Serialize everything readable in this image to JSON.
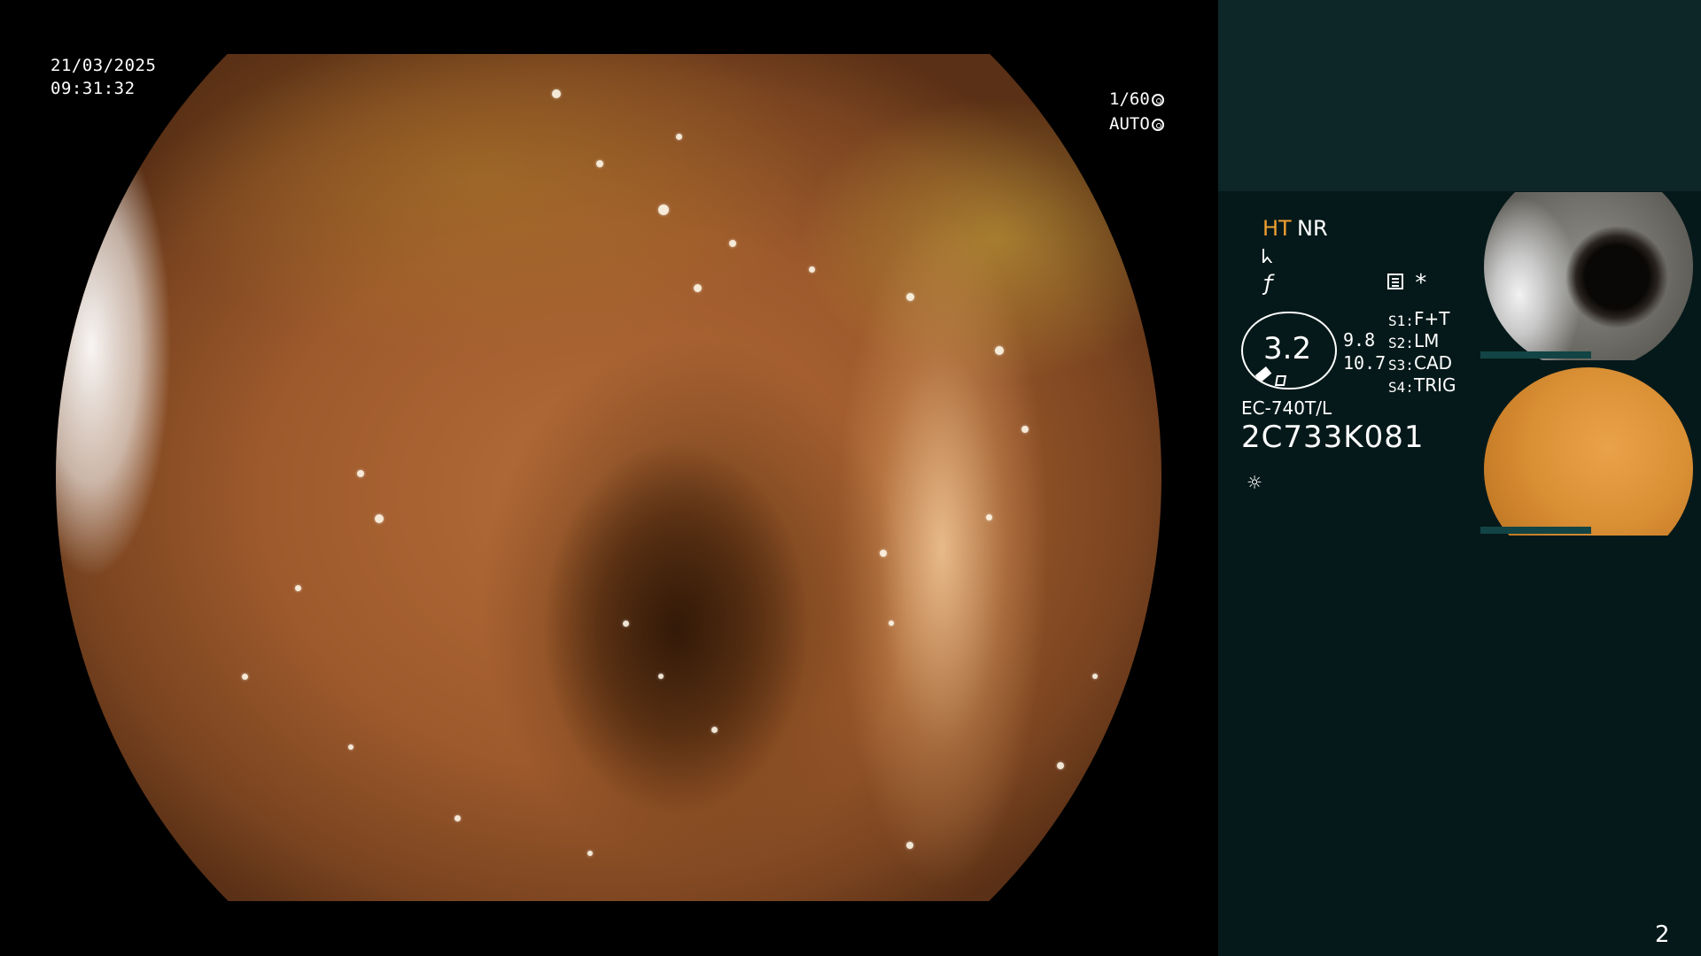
{
  "overlay": {
    "date": "21/03/2025",
    "time": "09:31:32",
    "shutter": "1/60",
    "iris": "AUTO"
  },
  "panel": {
    "mode_ht": "HT",
    "mode_nr": "NR",
    "enhance_icon": "structure-enhance-icon",
    "color_icon": "color-mode-icon",
    "memo_icon": "memo-icon",
    "asterisk": "*",
    "zoom_value": "3.2",
    "zoom_a": "9.8",
    "zoom_b": "10.7",
    "switches": [
      {
        "label": "S1:",
        "value": "F+T"
      },
      {
        "label": "S2:",
        "value": "LM"
      },
      {
        "label": "S3:",
        "value": "CAD"
      },
      {
        "label": "S4:",
        "value": "TRIG"
      }
    ],
    "scope_model": "EC-740T/L",
    "scope_serial": "2C733K081",
    "light_icon": "light-icon"
  },
  "page_number": "2",
  "colors": {
    "panel_bg": "#06191a",
    "panel_header_bg": "#0d2628",
    "ht_accent": "#f0a030",
    "text": "#ffffff"
  }
}
